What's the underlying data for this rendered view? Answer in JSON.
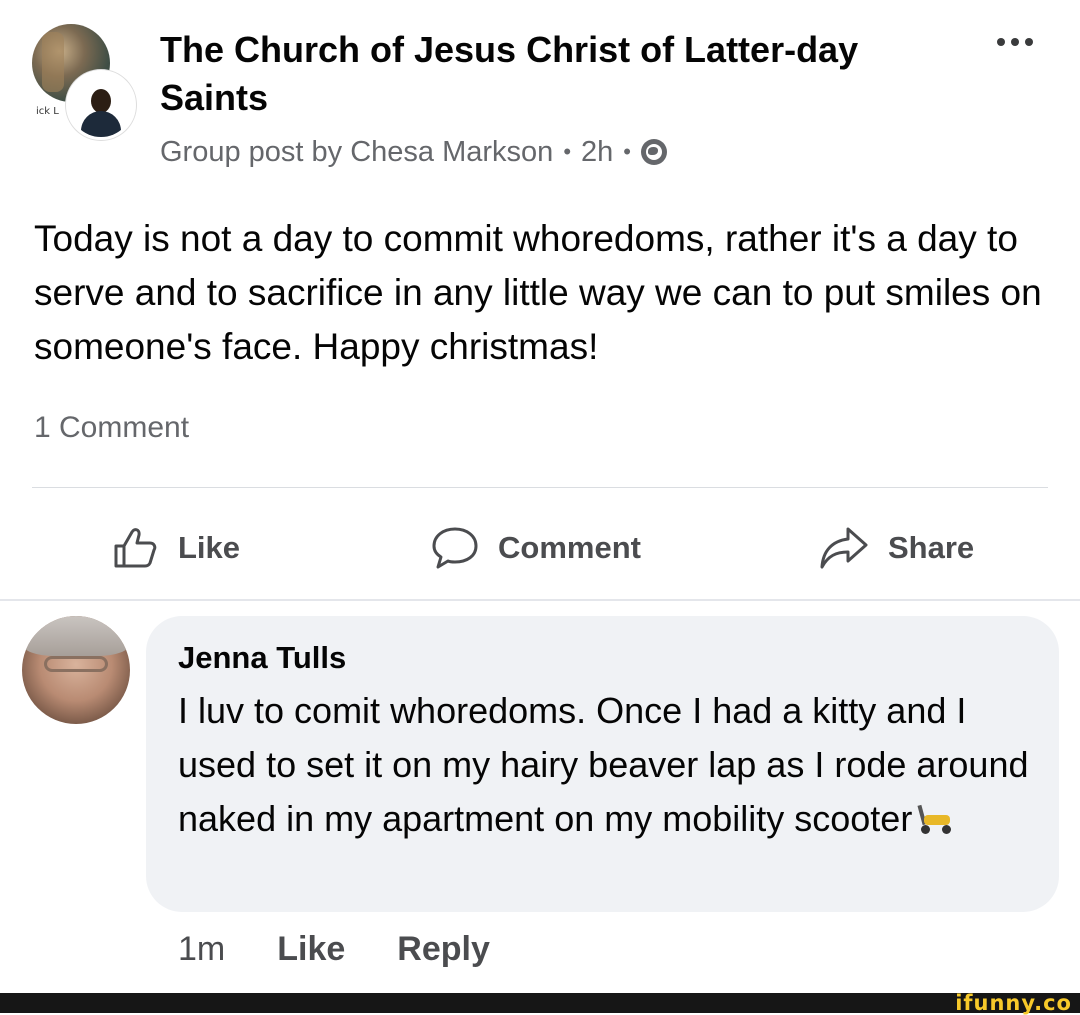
{
  "post": {
    "group_name": "The Church of Jesus Christ of Latter-day Saints",
    "author_line": "Group post by Chesa Markson",
    "time": "2h",
    "separator": "•",
    "avatar_tag": "ick L",
    "body": "Today is not a day to commit whoredoms, rather it's a day to serve and to sacrifice in any little way we can to put smiles on someone's face. Happy christmas!",
    "comment_count": "1 Comment"
  },
  "actions": {
    "like": "Like",
    "comment": "Comment",
    "share": "Share"
  },
  "comment": {
    "author": "Jenna Tulls",
    "text": "I luv to comit whoredoms. Once I had a kitty and I used to set it on my hairy beaver lap as I rode around naked in my apartment on my mobility scooter",
    "time": "1m",
    "like": "Like",
    "reply": "Reply"
  },
  "watermark": "ifunny.co",
  "colors": {
    "secondary_text": "#65676b",
    "bubble": "#f0f2f5",
    "action_text": "#4b4c4f",
    "watermark": "#f7c92a"
  }
}
